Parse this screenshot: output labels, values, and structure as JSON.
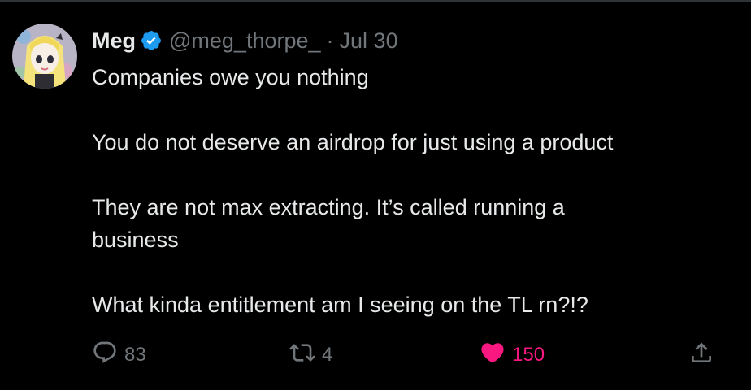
{
  "tweet": {
    "name": "Meg",
    "handle": "@meg_thorpe_",
    "separator": "·",
    "date": "Jul 30",
    "paragraphs": [
      "Companies owe you nothing",
      "You do not deserve an airdrop for just using a product",
      "They are not max extracting. It’s called running a business",
      "What kinda entitlement am I seeing on the TL rn?!?"
    ]
  },
  "actions": {
    "reply_count": "83",
    "retweet_count": "4",
    "like_count": "150"
  },
  "colors": {
    "background": "#000000",
    "text": "#e7e9ea",
    "muted": "#71767b",
    "verified": "#1d9bf0",
    "like": "#f91880"
  },
  "icons": {
    "verified": "verified-badge-icon",
    "reply": "reply-icon",
    "retweet": "retweet-icon",
    "like": "heart-icon",
    "share": "share-icon"
  }
}
